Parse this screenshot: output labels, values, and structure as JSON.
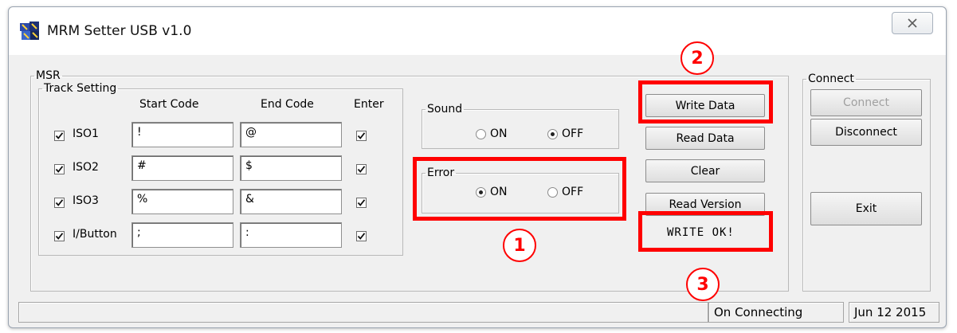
{
  "window": {
    "title": "MRM Setter USB v1.0",
    "close_icon": "close-icon"
  },
  "msr": {
    "group_label": "MSR",
    "track_group_label": "Track Setting",
    "headers": {
      "start": "Start Code",
      "end": "End Code",
      "enter": "Enter"
    },
    "tracks": [
      {
        "label": "ISO1",
        "checked": true,
        "start": "!",
        "end": "@",
        "enter": true
      },
      {
        "label": "ISO2",
        "checked": true,
        "start": "#",
        "end": "$",
        "enter": true
      },
      {
        "label": "ISO3",
        "checked": true,
        "start": "%",
        "end": "&",
        "enter": true
      },
      {
        "label": "I/Button",
        "checked": true,
        "start": ";",
        "end": ":",
        "enter": true
      }
    ]
  },
  "sound": {
    "label": "Sound",
    "on": "ON",
    "off": "OFF",
    "selected": "OFF"
  },
  "error": {
    "label": "Error",
    "on": "ON",
    "off": "OFF",
    "selected": "ON"
  },
  "buttons": {
    "write_data": "Write Data",
    "read_data": "Read Data",
    "clear": "Clear",
    "read_version": "Read Version",
    "result": "WRITE OK!"
  },
  "connect": {
    "group_label": "Connect",
    "connect": "Connect",
    "disconnect": "Disconnect",
    "exit": "Exit"
  },
  "status": {
    "connection": "On Connecting",
    "date": "Jun 12 2015"
  },
  "annotations": {
    "one": "1",
    "two": "2",
    "three": "3",
    "color": "#ff0000"
  }
}
